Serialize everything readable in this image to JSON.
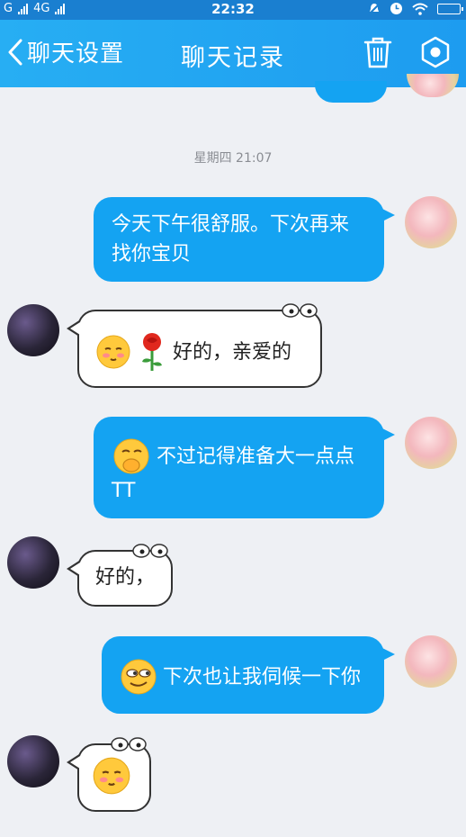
{
  "status_bar": {
    "carrier_left": "G",
    "network": "4G",
    "time": "22:32"
  },
  "header": {
    "back_label": "聊天设置",
    "title": "聊天记录"
  },
  "timestamp": "星期四 21:07",
  "messages": [
    {
      "side": "out",
      "text_line1": "今天下午很舒服。下次再来",
      "text_line2": "找你宝贝"
    },
    {
      "side": "in",
      "text": "好的，亲爱的"
    },
    {
      "side": "out",
      "text_line1": "不过记得准备大一点点",
      "text_line2": "TT"
    },
    {
      "side": "in",
      "text": "好的，"
    },
    {
      "side": "out",
      "text": "下次也让我伺候一下你"
    },
    {
      "side": "in",
      "text": ""
    }
  ],
  "colors": {
    "header": "#1d9cf0",
    "outgoing_bubble": "#14a3f2",
    "background": "#eef0f4"
  }
}
